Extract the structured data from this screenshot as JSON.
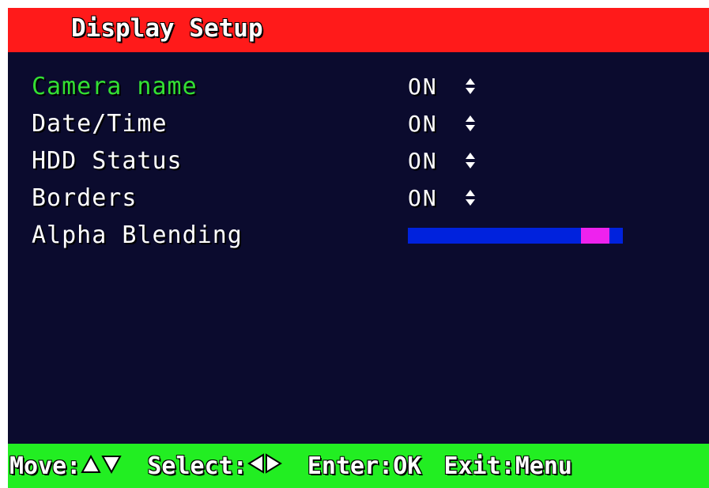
{
  "header": {
    "title": "Display Setup",
    "bg_color": "#ff1a1a"
  },
  "menu": {
    "items": [
      {
        "label": "Camera name",
        "value": "ON",
        "control": "updown-icon",
        "selected": true
      },
      {
        "label": "Date/Time",
        "value": "ON",
        "control": "updown-icon",
        "selected": false
      },
      {
        "label": "HDD Status",
        "value": "ON",
        "control": "updown-icon",
        "selected": false
      },
      {
        "label": "Borders",
        "value": "ON",
        "control": "updown-icon",
        "selected": false
      },
      {
        "label": "Alpha Blending",
        "control": "slider",
        "level_fraction": 0.87,
        "selected": false
      }
    ]
  },
  "footer": {
    "move_label": "Move:",
    "move_icons": [
      "up-triangle-icon",
      "down-triangle-icon"
    ],
    "select_label": "Select:",
    "select_icons": [
      "left-triangle-icon",
      "right-triangle-icon"
    ],
    "enter_label": "Enter:OK",
    "exit_label": "Exit:Menu",
    "bg_color": "#22ee22"
  },
  "colors": {
    "background": "#0b0b2e",
    "selected_text": "#33e033",
    "text": "#ffffff",
    "slider_track": "#0022dd",
    "slider_handle": "#ee22ee"
  }
}
